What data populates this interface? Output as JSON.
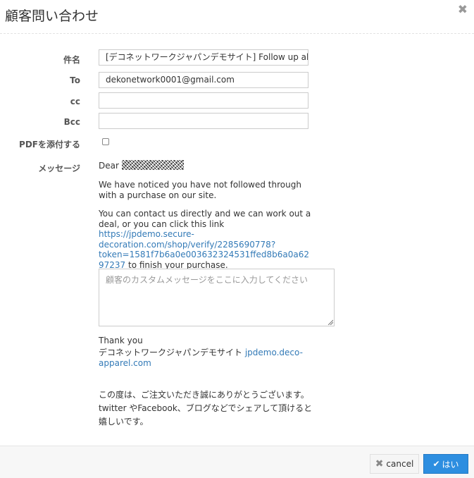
{
  "dialog": {
    "title": "顧客問い合わせ"
  },
  "fields": {
    "subject_label": "件名",
    "subject_value": "[デコネットワークジャパンデモサイト] Follow up ab",
    "to_label": "To",
    "to_value": "dekonetwork0001@gmail.com",
    "cc_label": "cc",
    "cc_value": "",
    "bcc_label": "Bcc",
    "bcc_value": "",
    "pdf_label": "PDFを添付する",
    "pdf_checked": false
  },
  "message": {
    "label": "メッセージ",
    "greeting": "Dear",
    "para1": "We have noticed you have not followed through with a purchase on our site.",
    "para2_before": "You can contact us directly and we can work out a deal, or you can click this link ",
    "link1": "https://jpdemo.secure-decoration.com/shop/verify/2285690778?token=1581f7b6a0e003632324531ffed8b6a0a6297237",
    "para2_after": " to finish your purchase.",
    "custom_placeholder": "顧客のカスタムメッセージをここに入力してください",
    "thanks": "Thank you",
    "signature_name": "デコネットワークジャパンデモサイト",
    "signature_link": "jpdemo.deco-apparel.com",
    "closing_line1": "この度は、ご注文いただき誠にありがとうございます。",
    "closing_line2": "twitter やFacebook、ブログなどでシェアして頂けると",
    "closing_line3": "嬉しいです。"
  },
  "footer": {
    "cancel_label": "cancel",
    "ok_label": "はい"
  },
  "icons": {
    "close": "close-icon",
    "cancel": "x-icon",
    "ok": "check-icon"
  },
  "colors": {
    "primary": "#2d8ee0",
    "link": "#337ab7"
  }
}
